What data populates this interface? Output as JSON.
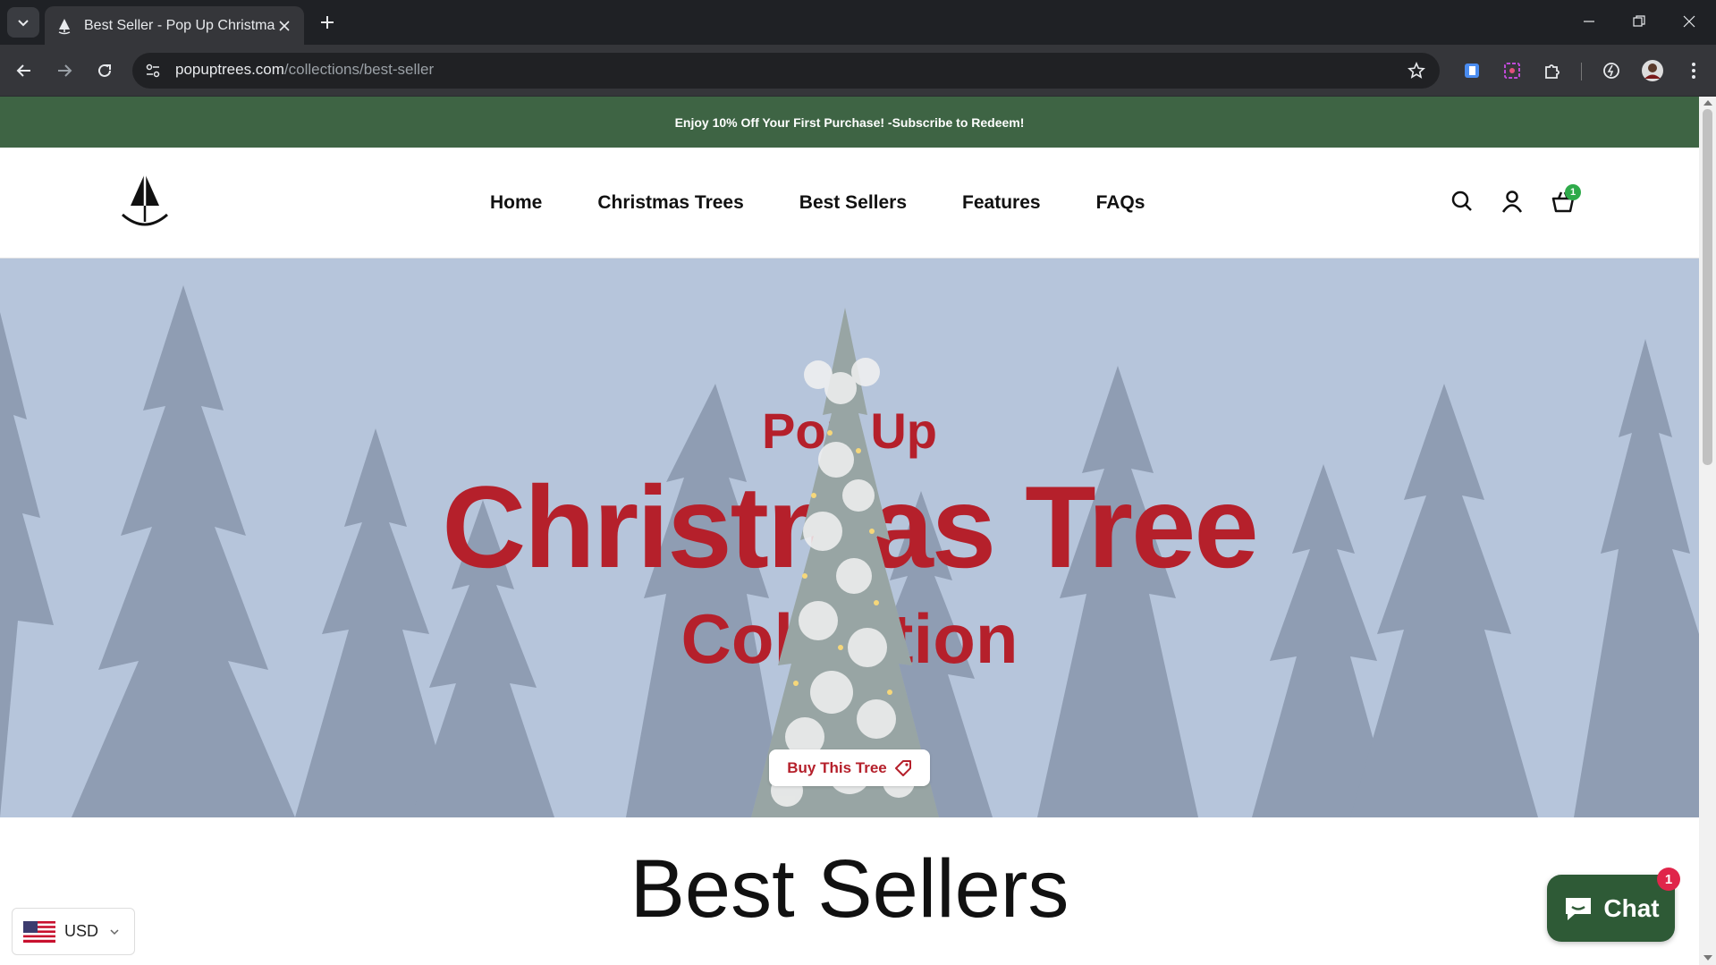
{
  "browser": {
    "tab_title": "Best Seller - Pop Up Christmas T",
    "url_host": "popuptrees.com",
    "url_path": "/collections/best-seller"
  },
  "announcement": "Enjoy 10% Off Your First Purchase! -Subscribe to Redeem!",
  "nav": {
    "items": [
      {
        "label": "Home"
      },
      {
        "label": "Christmas Trees"
      },
      {
        "label": "Best Sellers"
      },
      {
        "label": "Features"
      },
      {
        "label": "FAQs"
      }
    ],
    "cart_count": "1"
  },
  "hero": {
    "line1": "Pop Up",
    "line2": "Christmas Tree",
    "line3": "Collection",
    "button_label": "Buy This Tree"
  },
  "section_title": "Best Sellers",
  "currency": {
    "code": "USD"
  },
  "chat": {
    "label": "Chat",
    "badge": "1"
  },
  "colors": {
    "announcement_bg": "#3e6444",
    "hero_bg": "#b6c5db",
    "hero_text": "#b5202b",
    "cart_badge": "#2eaa4a",
    "chat_bg": "#2e5a36",
    "chat_badge": "#e0254a"
  }
}
